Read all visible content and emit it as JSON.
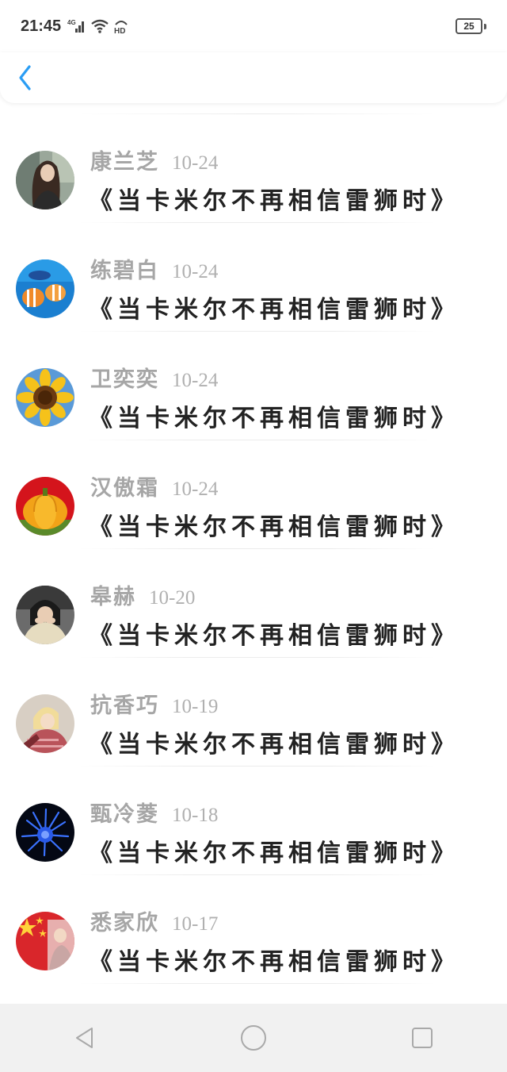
{
  "status_bar": {
    "time": "21:45",
    "network": "4G",
    "hd": "HD",
    "battery": "25"
  },
  "header": {
    "back_icon": "chevron-left-icon",
    "accent_color": "#2a9df4"
  },
  "list": {
    "items": [
      {
        "name": "康兰芝",
        "date": "10-24",
        "title": "《当卡米尔不再相信雷狮时》",
        "avatar": "woman-portrait"
      },
      {
        "name": "练碧白",
        "date": "10-24",
        "title": "《当卡米尔不再相信雷狮时》",
        "avatar": "tropical-fish"
      },
      {
        "name": "卫奕奕",
        "date": "10-24",
        "title": "《当卡米尔不再相信雷狮时》",
        "avatar": "sunflower"
      },
      {
        "name": "汉傲霜",
        "date": "10-24",
        "title": "《当卡米尔不再相信雷狮时》",
        "avatar": "pumpkin"
      },
      {
        "name": "皋赫",
        "date": "10-20",
        "title": "《当卡米尔不再相信雷狮时》",
        "avatar": "girl-covering-face"
      },
      {
        "name": "抗香巧",
        "date": "10-19",
        "title": "《当卡米尔不再相信雷狮时》",
        "avatar": "anime-character"
      },
      {
        "name": "甄冷菱",
        "date": "10-18",
        "title": "《当卡米尔不再相信雷狮时》",
        "avatar": "blue-flower"
      },
      {
        "name": "悉家欣",
        "date": "10-17",
        "title": "《当卡米尔不再相信雷狮时》",
        "avatar": "flag-figure"
      }
    ]
  },
  "nav_bar": {
    "back": "triangle-back-icon",
    "home": "circle-home-icon",
    "recents": "square-recents-icon"
  }
}
